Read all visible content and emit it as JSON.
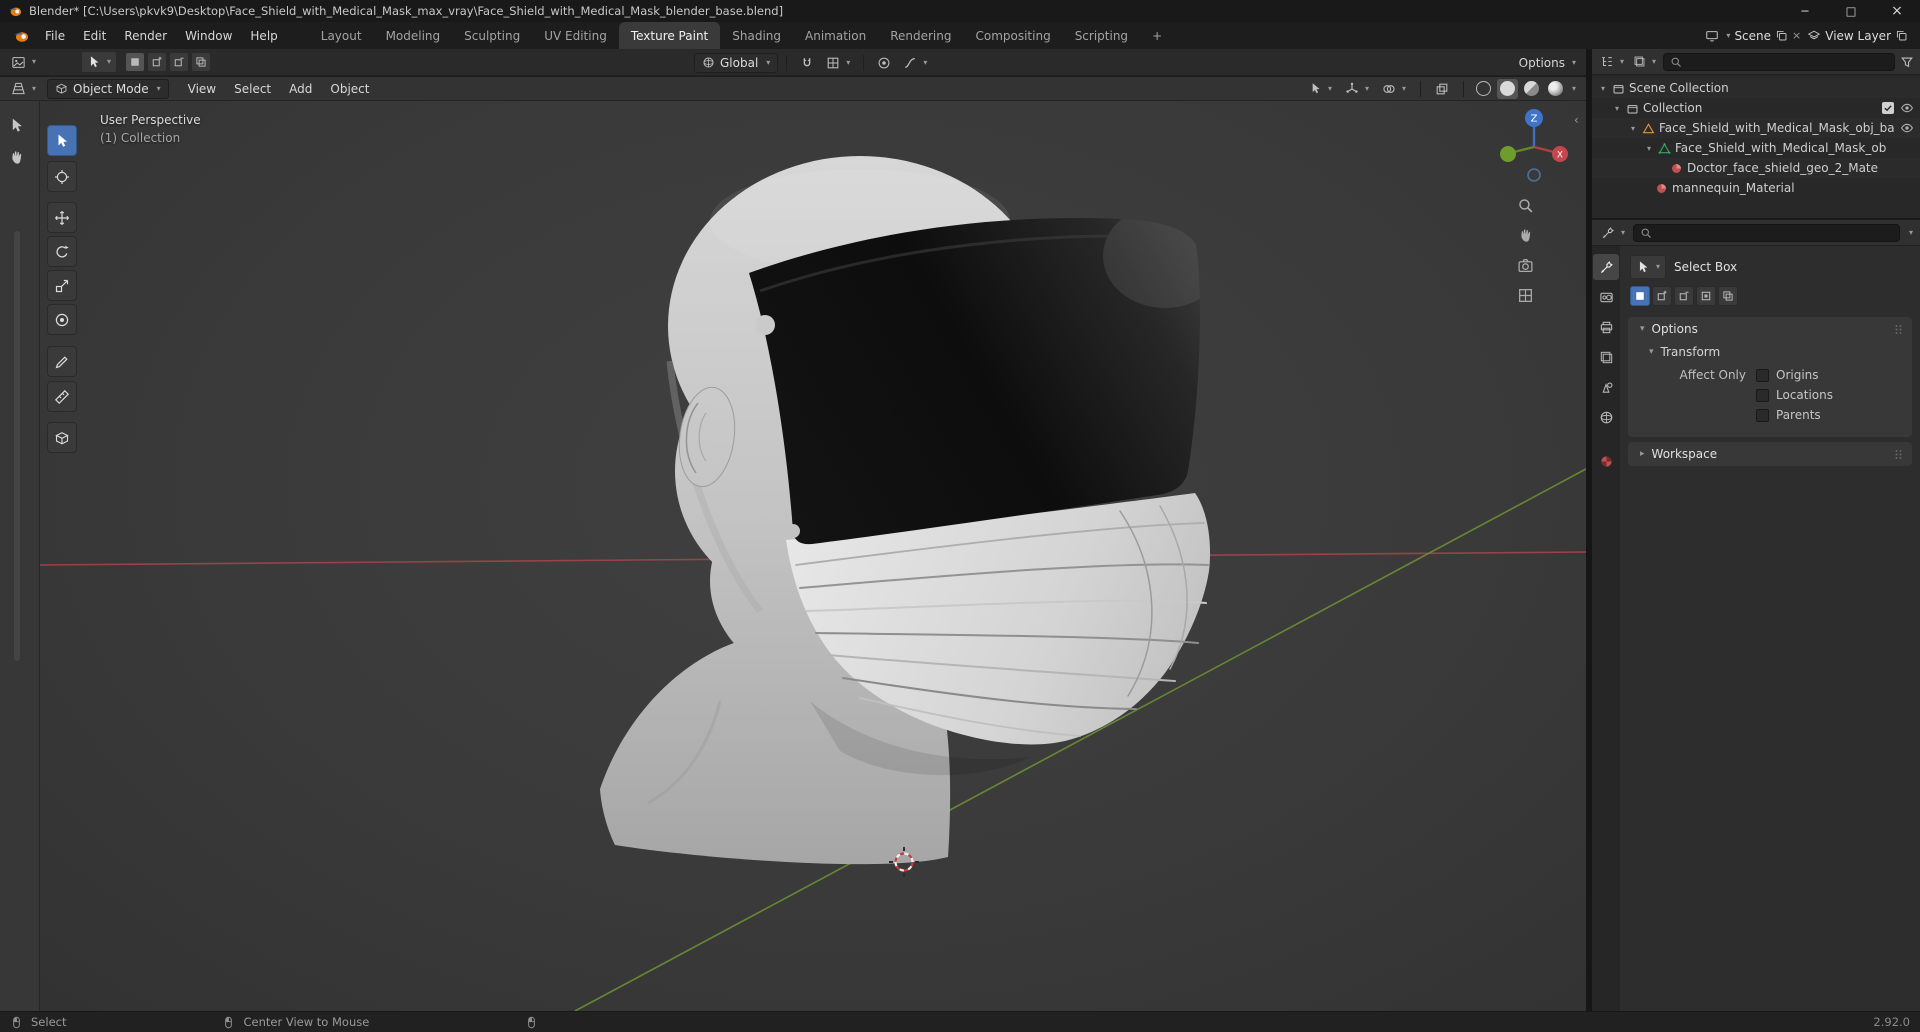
{
  "window": {
    "title": "Blender* [C:\\Users\\pkvk9\\Desktop\\Face_Shield_with_Medical_Mask_max_vray\\Face_Shield_with_Medical_Mask_blender_base.blend]"
  },
  "topbar": {
    "menus": [
      "File",
      "Edit",
      "Render",
      "Window",
      "Help"
    ],
    "tabs": [
      {
        "label": "Layout"
      },
      {
        "label": "Modeling"
      },
      {
        "label": "Sculpting"
      },
      {
        "label": "UV Editing"
      },
      {
        "label": "Texture Paint"
      },
      {
        "label": "Shading"
      },
      {
        "label": "Animation"
      },
      {
        "label": "Rendering"
      },
      {
        "label": "Compositing"
      },
      {
        "label": "Scripting"
      }
    ],
    "active_tab": "Texture Paint",
    "new_tab_label": "+",
    "scene_label": "Scene",
    "view_layer_label": "View Layer"
  },
  "tool_settings": {
    "orientation": "Global",
    "options_label": "Options"
  },
  "viewport": {
    "mode": "Object Mode",
    "menus": [
      "View",
      "Select",
      "Add",
      "Object"
    ],
    "overlay": {
      "line1": "User Perspective",
      "line2": "(1) Collection"
    },
    "gizmo": {
      "z": "Z",
      "x": "X"
    }
  },
  "outliner": {
    "items": [
      {
        "label": "Scene Collection"
      },
      {
        "label": "Collection"
      },
      {
        "label": "Face_Shield_with_Medical_Mask_obj_ba"
      },
      {
        "label": "Face_Shield_with_Medical_Mask_ob"
      },
      {
        "label": "Doctor_face_shield_geo_2_Mate"
      },
      {
        "label": "mannequin_Material"
      }
    ]
  },
  "properties": {
    "tool_name": "Select Box",
    "options_header": "Options",
    "transform_header": "Transform",
    "affect_only_label": "Affect Only",
    "affect_only": [
      {
        "label": "Origins",
        "checked": false
      },
      {
        "label": "Locations",
        "checked": false
      },
      {
        "label": "Parents",
        "checked": false
      }
    ],
    "workspace_header": "Workspace"
  },
  "statusbar": {
    "select": "Select",
    "center_view": "Center View to Mouse",
    "version": "2.92.0"
  },
  "colors": {
    "accent": "#4772b3",
    "axis_x": "#a1454b",
    "axis_y": "#6e8f33",
    "object_icon": "#e8913c",
    "mesh_icon": "#35b567",
    "material_icon": "#c2504f"
  }
}
